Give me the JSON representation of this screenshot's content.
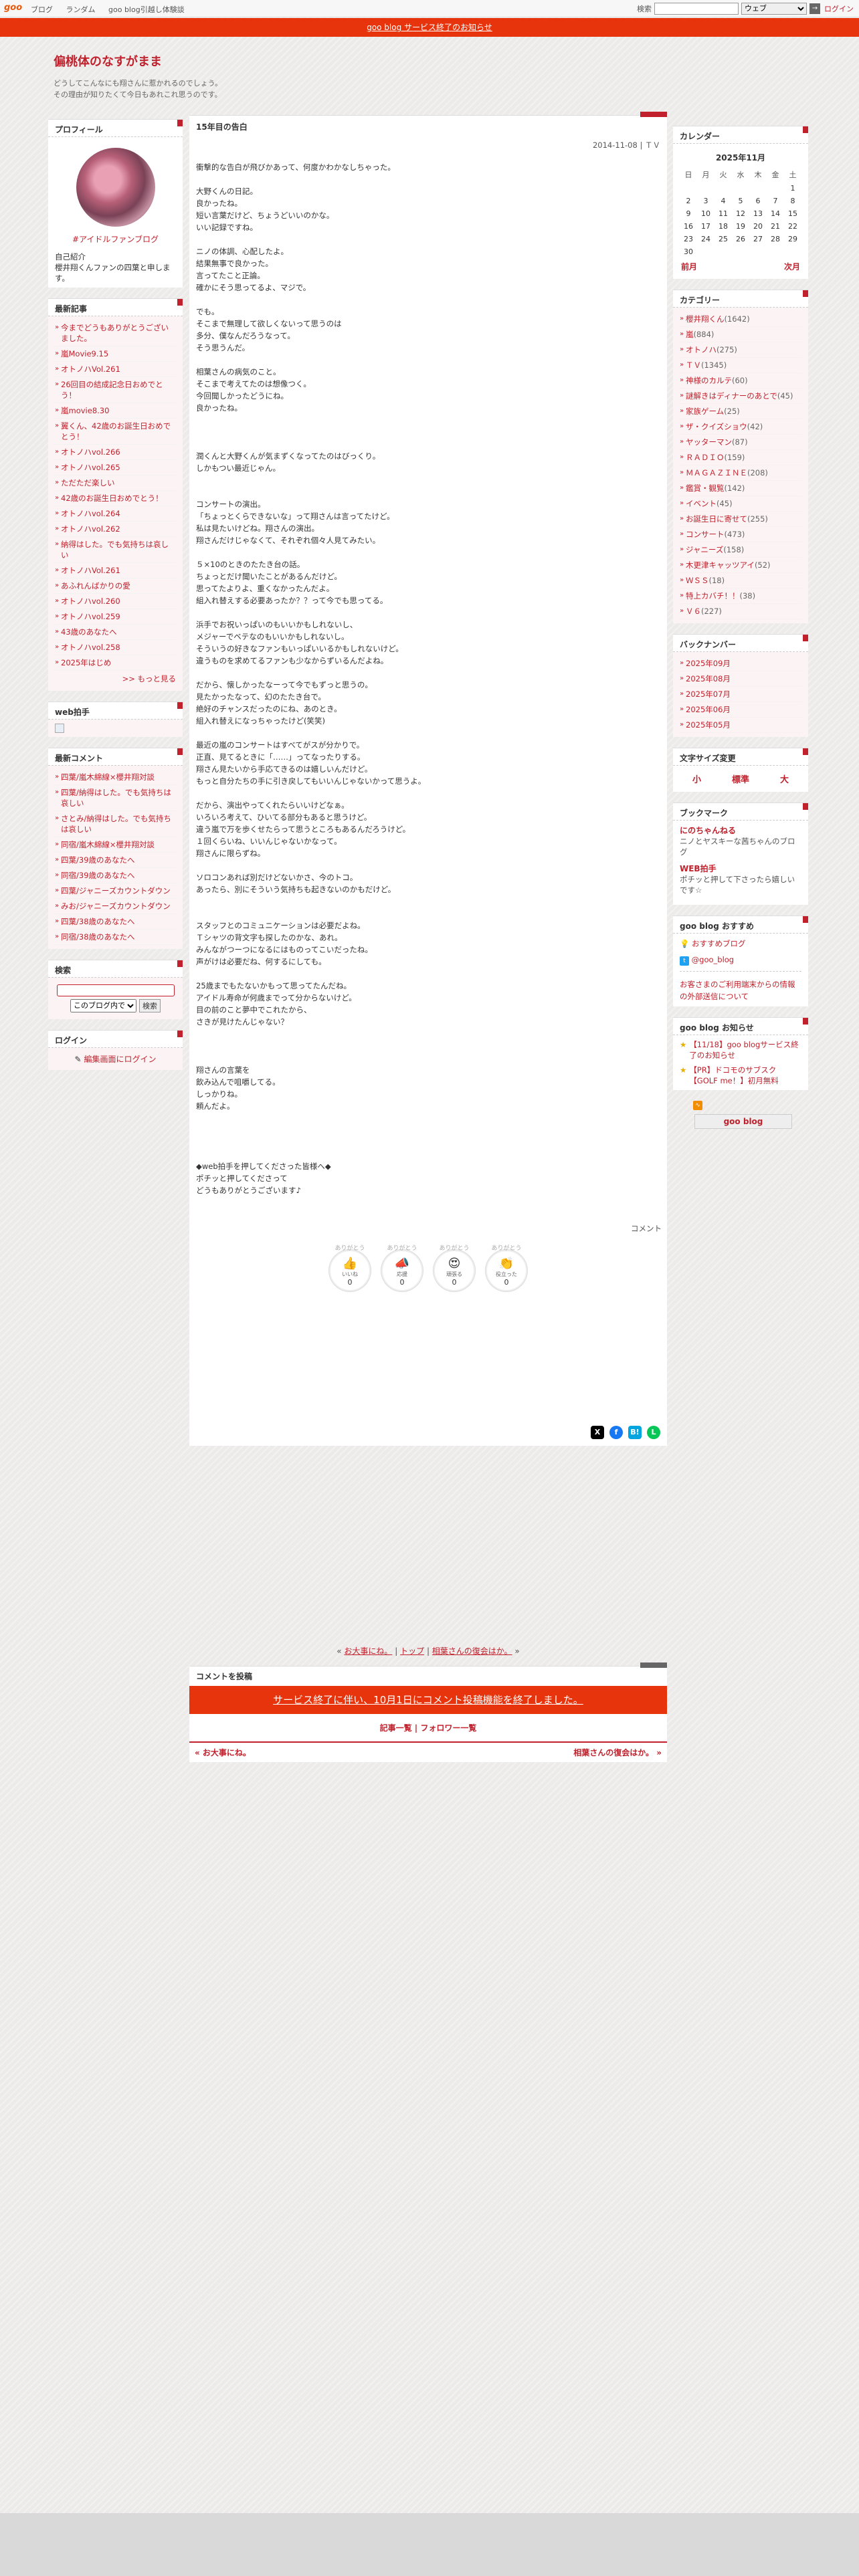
{
  "topbar": {
    "logo": "goo",
    "nav": [
      "ブログ",
      "ランダム",
      "goo blog引越し体験談"
    ],
    "search_label": "検索",
    "search_value": "",
    "search_scope": "ウェブ",
    "go_label": "→",
    "login": "ログイン"
  },
  "notice": "goo blog サービス終了のお知らせ",
  "header": {
    "title": "偏桃体のなすがまま",
    "desc1": "どうしてこんなにも翔さんに惹かれるのでしょう。",
    "desc2": "その理由が知りたくて今日もあれこれ思うのです。"
  },
  "left": {
    "profile_title": "プロフィール",
    "profile_tag": "#アイドルファンブログ",
    "profile_intro_label": "自己紹介",
    "profile_intro": "櫻井翔くんファンの四葉と申します。",
    "recent_title": "最新記事",
    "recent": [
      "今までどうもありがとうございました。",
      "嵐Movie9.15",
      "オトノハVol.261",
      "26回目の結成記念日おめでとう！",
      "嵐movie8.30",
      "翼くん、42歳のお誕生日おめでとう！",
      "オトノハvol.266",
      "オトノハvol.265",
      "ただただ楽しい",
      "42歳のお誕生日おめでとう！",
      "オトノハvol.264",
      "オトノハvol.262",
      "納得はした。でも気持ちは哀しい",
      "オトノハVol.261",
      "あふれんばかりの愛",
      "オトノハvol.260",
      "オトノハvol.259",
      "43歳のあなたへ",
      "オトノハvol.258",
      "2025年はじめ"
    ],
    "recent_more": ">> もっと見る",
    "webclap_title": "web拍手",
    "recent_comments_title": "最新コメント",
    "recent_comments": [
      "四葉/嵐木綿線×櫻井翔対談",
      "四葉/納得はした。でも気持ちは哀しい",
      "さとみ/納得はした。でも気持ちは哀しい",
      "同宿/嵐木綿線×櫻井翔対談",
      "四葉/39歳のあなたへ",
      "同宿/39歳のあなたへ",
      "四葉/ジャニーズカウントダウン",
      "みお/ジャニーズカウントダウン",
      "四葉/38歳のあなたへ",
      "同宿/38歳のあなたへ"
    ],
    "search_title": "検索",
    "search_scope": "このブログ内で",
    "search_button": "検索",
    "login_title": "ログイン",
    "login_link": "編集画面にログイン"
  },
  "main": {
    "title": "15年目の告白",
    "meta": "2014-11-08 | ＴＶ",
    "content": [
      "衝撃的な告白が飛びかあって、何度かわかなしちゃった。",
      "",
      "大野くんの日記。",
      "良かったね。",
      "短い言葉だけど、ちょうどいいのかな。",
      "いい記録ですね。",
      "",
      "ニノの体調、心配したよ。",
      "結果無事で良かった。",
      "言ってたこと正論。",
      "確かにそう思ってるよ、マジで。",
      "",
      "でも。",
      "そこまで無理して欲しくないって思うのは",
      "多分、僕なんだろうなって。",
      "そう思うんだ。",
      "",
      "相葉さんの病気のこと。",
      "そこまで考えてたのは想像つく。",
      "今回聞しかったどうにね。",
      "良かったね。",
      "",
      "",
      "",
      "潤くんと大野くんが気まずくなってたのはびっくり。",
      "しかもつい最近じゃん。",
      "",
      "",
      "コンサートの演出。",
      "「ちょっとくらできないな」って翔さんは言ってたけど。",
      "私は見たいけどね。翔さんの演出。",
      "翔さんだけじゃなくて、それぞれ個々人見てみたい。",
      "",
      "５×10のときのたたき台の話。",
      "ちょっとだけ聞いたことがあるんだけど。",
      "思ってたよりよ、重くなかったんだよ。",
      "組入れ替えする必要あったか？？って今でも思ってる。",
      "",
      "浜手でお祝いっぱいのもいいかもしれないし、",
      "メジャーでベテなのもいいかもしれないし。",
      "そういうの好きなファンもいっぱいいるかもしれないけど。",
      "違うものを求めてるファンも少なからずいるんだよね。",
      "",
      "だから、懐しかったなーって今でもずっと思うの。",
      "見たかったなって、幻のたたき台で。",
      "絶好のチャンスだったのにね、あのとき。",
      "組入れ替えになっちゃったけど(笑笑)",
      "",
      "最近の嵐のコンサートはすべてがスが分かりで。",
      "正直、見てるときに「……」ってなったりする。",
      "翔さん見たいから手応てきるのは嬉しいんだけど。",
      "もっと自分たちの手に引き戻してもいいんじゃないかって思うよ。",
      "",
      "だから、演出やってくれたらいいけどなぁ。",
      "いろいろ考えて、ひいてる部分もあると思うけど。",
      "違う嵐で万を歩くせたらって思うところもあるんだろうけど。",
      "１回くらいね、いいんじゃないかなって。",
      "翔さんに限らずね。",
      "",
      "ソロコンあれば別だけどないかさ、今のトコ。",
      "あったら、別にそういう気持ちも起きないのかもだけど。",
      "",
      "",
      "スタッフとのコミュニケーションは必要だよね。",
      "Ｔシャツの背文字も探したのかな、あれ。",
      "みんながつーつになるにはものってこいだったね。",
      "声がけは必要だね、何するにしても。",
      "",
      "25歳までもたないかもって思ってたんだね。",
      "アイドル寿命が何歳までって分からないけど。",
      "目の前のこと夢中でこれたから、",
      "さきが見けたんじゃない？",
      "",
      "",
      "",
      "翔さんの言葉を",
      "飲み込んで咀嚼してる。",
      "しっかりね。",
      "頼んだよ。",
      "",
      "",
      "",
      "",
      "◆web拍手を押してくださった皆様へ◆",
      "ポチッと押してくださって",
      "どうもありがとうございます♪"
    ],
    "comment_link": "コメント",
    "reactions": [
      {
        "top": "ありがとう",
        "glyph": "👍",
        "label": "いいね",
        "count": "0"
      },
      {
        "top": "ありがとう",
        "glyph": "📣",
        "label": "応援",
        "count": "0"
      },
      {
        "top": "ありがとう",
        "glyph": "😍",
        "label": "頑張る",
        "count": "0"
      },
      {
        "top": "ありがとう",
        "glyph": "👏",
        "label": "役立った",
        "count": "0"
      }
    ],
    "share": [
      "X",
      "f",
      "B!",
      "L"
    ],
    "pager_prev": "お大事にね。",
    "pager_top": "トップ",
    "pager_next": "相葉さんの復会はか。",
    "comments_title": "コメントを投稿",
    "comments_notice": "サービス終了に伴い、10月1日にコメント投稿機能を終了しました。",
    "links": "記事一覧 | フォロワー一覧",
    "prev": "« お大事にね。",
    "next": "相葉さんの復会はか。 »"
  },
  "right": {
    "calendar_title": "カレンダー",
    "calendar_month": "2025年11月",
    "weekdays": [
      "日",
      "月",
      "火",
      "水",
      "木",
      "金",
      "土"
    ],
    "weeks": [
      [
        "",
        "",
        "",
        "",
        "",
        "",
        "1"
      ],
      [
        "2",
        "3",
        "4",
        "5",
        "6",
        "7",
        "8"
      ],
      [
        "9",
        "10",
        "11",
        "12",
        "13",
        "14",
        "15"
      ],
      [
        "16",
        "17",
        "18",
        "19",
        "20",
        "21",
        "22"
      ],
      [
        "23",
        "24",
        "25",
        "26",
        "27",
        "28",
        "29"
      ],
      [
        "30",
        "",
        "",
        "",
        "",
        "",
        ""
      ]
    ],
    "calendar_prev": "前月",
    "calendar_next": "次月",
    "category_title": "カテゴリー",
    "categories": [
      {
        "name": "櫻井翔くん",
        "count": "(1642)"
      },
      {
        "name": "嵐",
        "count": "(884)"
      },
      {
        "name": "オトノハ",
        "count": "(275)"
      },
      {
        "name": "ＴＶ",
        "count": "(1345)"
      },
      {
        "name": "神様のカルテ",
        "count": "(60)"
      },
      {
        "name": "謎解きはディナーのあとで",
        "count": "(45)"
      },
      {
        "name": "家族ゲーム",
        "count": "(25)"
      },
      {
        "name": "ザ・クイズショウ",
        "count": "(42)"
      },
      {
        "name": "ヤッターマン",
        "count": "(87)"
      },
      {
        "name": "ＲＡＤＩＯ",
        "count": "(159)"
      },
      {
        "name": "ＭＡＧＡＺＩＮＥ",
        "count": "(208)"
      },
      {
        "name": "鑑賞・観覧",
        "count": "(142)"
      },
      {
        "name": "イベント",
        "count": "(45)"
      },
      {
        "name": "お誕生日に寄せて",
        "count": "(255)"
      },
      {
        "name": "コンサート",
        "count": "(473)"
      },
      {
        "name": "ジャニーズ",
        "count": "(158)"
      },
      {
        "name": "木更津キャッツアイ",
        "count": "(52)"
      },
      {
        "name": "ＷＳＳ",
        "count": "(18)"
      },
      {
        "name": "特上カバチ！！",
        "count": "(38)"
      },
      {
        "name": "Ｖ６",
        "count": "(227)"
      }
    ],
    "backnumber_title": "バックナンバー",
    "backnumbers": [
      "2025年09月",
      "2025年08月",
      "2025年07月",
      "2025年06月",
      "2025年05月"
    ],
    "fontsize_title": "文字サイズ変更",
    "fontsizes": [
      "小",
      "標準",
      "大"
    ],
    "bookmark_title": "ブックマーク",
    "bookmarks": [
      {
        "name": "にのちゃんねる",
        "desc": "ニノとヤスキーな茜ちゃんのブログ"
      },
      {
        "name": "WEB拍手",
        "desc": "ポチッと押して下さったら嬉しいです☆"
      }
    ],
    "recommend_title": "goo blog おすすめ",
    "recommend_link": "おすすめブログ",
    "recommend_x": "@goo_blog",
    "recommend_notice": "お客さまのご利用端末からの情報の外部送信について",
    "news_title": "goo blog お知らせ",
    "news": [
      "【11/18】goo blogサービス終了のお知らせ",
      "【PR】ドコモのサブスク【GOLF me！】初月無料"
    ],
    "footer_logo": "goo blog"
  }
}
